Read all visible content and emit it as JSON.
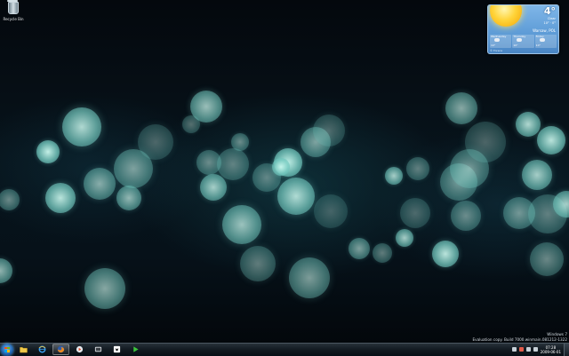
{
  "desktop": {
    "icons": [
      {
        "label": "Recycle Bin",
        "icon": "recycle-bin-icon"
      }
    ]
  },
  "weather": {
    "temperature": "4°",
    "condition": "Clear",
    "range": "10° · 0°",
    "location": "Warsaw, POL",
    "forecast": [
      {
        "day": "Wednesday",
        "high": "10°"
      },
      {
        "day": "Thursday",
        "high": "10°"
      },
      {
        "day": "Friday",
        "high": "10°"
      }
    ],
    "source": "© Foreca"
  },
  "watermark": {
    "line1": "Windows 7",
    "line2": "Evaluation copy. Build 7000.winmain.081212-1322"
  },
  "taskbar": {
    "items": [
      {
        "name": "start-button",
        "icon": "windows-logo-icon"
      },
      {
        "name": "explorer",
        "icon": "folder-icon"
      },
      {
        "name": "internet-explorer",
        "icon": "internet-explorer-icon"
      },
      {
        "name": "firefox",
        "icon": "firefox-icon",
        "active": true
      },
      {
        "name": "media-player",
        "icon": "media-player-icon"
      },
      {
        "name": "media-center",
        "icon": "media-center-icon"
      },
      {
        "name": "app",
        "icon": "app-icon"
      },
      {
        "name": "play",
        "icon": "play-icon"
      }
    ],
    "clock_time": "07:28",
    "clock_date": "2009-06-01",
    "tray_icons": [
      "network-icon",
      "volume-icon",
      "flag-icon",
      "battery-icon"
    ]
  },
  "colors": {
    "bokeh": "#8fe3d6",
    "taskbar": "#131b22",
    "weather_bg": "#5d9bd6",
    "accent_green": "#3cc43c"
  }
}
